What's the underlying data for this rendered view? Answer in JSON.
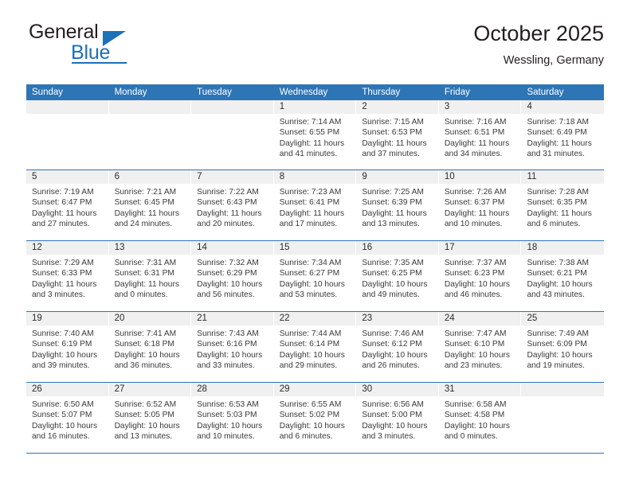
{
  "brand": {
    "name_top": "General",
    "name_bottom": "Blue",
    "accent_color": "#1c70b8"
  },
  "header": {
    "title": "October 2025",
    "subtitle": "Wessling, Germany"
  },
  "calendar": {
    "header_bg": "#2e75b6",
    "daynum_bg": "#f0f0f0",
    "weekdays": [
      "Sunday",
      "Monday",
      "Tuesday",
      "Wednesday",
      "Thursday",
      "Friday",
      "Saturday"
    ],
    "weeks": [
      [
        {
          "day": "",
          "sunrise": "",
          "sunset": "",
          "daylight1": "",
          "daylight2": ""
        },
        {
          "day": "",
          "sunrise": "",
          "sunset": "",
          "daylight1": "",
          "daylight2": ""
        },
        {
          "day": "",
          "sunrise": "",
          "sunset": "",
          "daylight1": "",
          "daylight2": ""
        },
        {
          "day": "1",
          "sunrise": "Sunrise: 7:14 AM",
          "sunset": "Sunset: 6:55 PM",
          "daylight1": "Daylight: 11 hours",
          "daylight2": "and 41 minutes."
        },
        {
          "day": "2",
          "sunrise": "Sunrise: 7:15 AM",
          "sunset": "Sunset: 6:53 PM",
          "daylight1": "Daylight: 11 hours",
          "daylight2": "and 37 minutes."
        },
        {
          "day": "3",
          "sunrise": "Sunrise: 7:16 AM",
          "sunset": "Sunset: 6:51 PM",
          "daylight1": "Daylight: 11 hours",
          "daylight2": "and 34 minutes."
        },
        {
          "day": "4",
          "sunrise": "Sunrise: 7:18 AM",
          "sunset": "Sunset: 6:49 PM",
          "daylight1": "Daylight: 11 hours",
          "daylight2": "and 31 minutes."
        }
      ],
      [
        {
          "day": "5",
          "sunrise": "Sunrise: 7:19 AM",
          "sunset": "Sunset: 6:47 PM",
          "daylight1": "Daylight: 11 hours",
          "daylight2": "and 27 minutes."
        },
        {
          "day": "6",
          "sunrise": "Sunrise: 7:21 AM",
          "sunset": "Sunset: 6:45 PM",
          "daylight1": "Daylight: 11 hours",
          "daylight2": "and 24 minutes."
        },
        {
          "day": "7",
          "sunrise": "Sunrise: 7:22 AM",
          "sunset": "Sunset: 6:43 PM",
          "daylight1": "Daylight: 11 hours",
          "daylight2": "and 20 minutes."
        },
        {
          "day": "8",
          "sunrise": "Sunrise: 7:23 AM",
          "sunset": "Sunset: 6:41 PM",
          "daylight1": "Daylight: 11 hours",
          "daylight2": "and 17 minutes."
        },
        {
          "day": "9",
          "sunrise": "Sunrise: 7:25 AM",
          "sunset": "Sunset: 6:39 PM",
          "daylight1": "Daylight: 11 hours",
          "daylight2": "and 13 minutes."
        },
        {
          "day": "10",
          "sunrise": "Sunrise: 7:26 AM",
          "sunset": "Sunset: 6:37 PM",
          "daylight1": "Daylight: 11 hours",
          "daylight2": "and 10 minutes."
        },
        {
          "day": "11",
          "sunrise": "Sunrise: 7:28 AM",
          "sunset": "Sunset: 6:35 PM",
          "daylight1": "Daylight: 11 hours",
          "daylight2": "and 6 minutes."
        }
      ],
      [
        {
          "day": "12",
          "sunrise": "Sunrise: 7:29 AM",
          "sunset": "Sunset: 6:33 PM",
          "daylight1": "Daylight: 11 hours",
          "daylight2": "and 3 minutes."
        },
        {
          "day": "13",
          "sunrise": "Sunrise: 7:31 AM",
          "sunset": "Sunset: 6:31 PM",
          "daylight1": "Daylight: 11 hours",
          "daylight2": "and 0 minutes."
        },
        {
          "day": "14",
          "sunrise": "Sunrise: 7:32 AM",
          "sunset": "Sunset: 6:29 PM",
          "daylight1": "Daylight: 10 hours",
          "daylight2": "and 56 minutes."
        },
        {
          "day": "15",
          "sunrise": "Sunrise: 7:34 AM",
          "sunset": "Sunset: 6:27 PM",
          "daylight1": "Daylight: 10 hours",
          "daylight2": "and 53 minutes."
        },
        {
          "day": "16",
          "sunrise": "Sunrise: 7:35 AM",
          "sunset": "Sunset: 6:25 PM",
          "daylight1": "Daylight: 10 hours",
          "daylight2": "and 49 minutes."
        },
        {
          "day": "17",
          "sunrise": "Sunrise: 7:37 AM",
          "sunset": "Sunset: 6:23 PM",
          "daylight1": "Daylight: 10 hours",
          "daylight2": "and 46 minutes."
        },
        {
          "day": "18",
          "sunrise": "Sunrise: 7:38 AM",
          "sunset": "Sunset: 6:21 PM",
          "daylight1": "Daylight: 10 hours",
          "daylight2": "and 43 minutes."
        }
      ],
      [
        {
          "day": "19",
          "sunrise": "Sunrise: 7:40 AM",
          "sunset": "Sunset: 6:19 PM",
          "daylight1": "Daylight: 10 hours",
          "daylight2": "and 39 minutes."
        },
        {
          "day": "20",
          "sunrise": "Sunrise: 7:41 AM",
          "sunset": "Sunset: 6:18 PM",
          "daylight1": "Daylight: 10 hours",
          "daylight2": "and 36 minutes."
        },
        {
          "day": "21",
          "sunrise": "Sunrise: 7:43 AM",
          "sunset": "Sunset: 6:16 PM",
          "daylight1": "Daylight: 10 hours",
          "daylight2": "and 33 minutes."
        },
        {
          "day": "22",
          "sunrise": "Sunrise: 7:44 AM",
          "sunset": "Sunset: 6:14 PM",
          "daylight1": "Daylight: 10 hours",
          "daylight2": "and 29 minutes."
        },
        {
          "day": "23",
          "sunrise": "Sunrise: 7:46 AM",
          "sunset": "Sunset: 6:12 PM",
          "daylight1": "Daylight: 10 hours",
          "daylight2": "and 26 minutes."
        },
        {
          "day": "24",
          "sunrise": "Sunrise: 7:47 AM",
          "sunset": "Sunset: 6:10 PM",
          "daylight1": "Daylight: 10 hours",
          "daylight2": "and 23 minutes."
        },
        {
          "day": "25",
          "sunrise": "Sunrise: 7:49 AM",
          "sunset": "Sunset: 6:09 PM",
          "daylight1": "Daylight: 10 hours",
          "daylight2": "and 19 minutes."
        }
      ],
      [
        {
          "day": "26",
          "sunrise": "Sunrise: 6:50 AM",
          "sunset": "Sunset: 5:07 PM",
          "daylight1": "Daylight: 10 hours",
          "daylight2": "and 16 minutes."
        },
        {
          "day": "27",
          "sunrise": "Sunrise: 6:52 AM",
          "sunset": "Sunset: 5:05 PM",
          "daylight1": "Daylight: 10 hours",
          "daylight2": "and 13 minutes."
        },
        {
          "day": "28",
          "sunrise": "Sunrise: 6:53 AM",
          "sunset": "Sunset: 5:03 PM",
          "daylight1": "Daylight: 10 hours",
          "daylight2": "and 10 minutes."
        },
        {
          "day": "29",
          "sunrise": "Sunrise: 6:55 AM",
          "sunset": "Sunset: 5:02 PM",
          "daylight1": "Daylight: 10 hours",
          "daylight2": "and 6 minutes."
        },
        {
          "day": "30",
          "sunrise": "Sunrise: 6:56 AM",
          "sunset": "Sunset: 5:00 PM",
          "daylight1": "Daylight: 10 hours",
          "daylight2": "and 3 minutes."
        },
        {
          "day": "31",
          "sunrise": "Sunrise: 6:58 AM",
          "sunset": "Sunset: 4:58 PM",
          "daylight1": "Daylight: 10 hours",
          "daylight2": "and 0 minutes."
        },
        {
          "day": "",
          "sunrise": "",
          "sunset": "",
          "daylight1": "",
          "daylight2": ""
        }
      ]
    ]
  }
}
